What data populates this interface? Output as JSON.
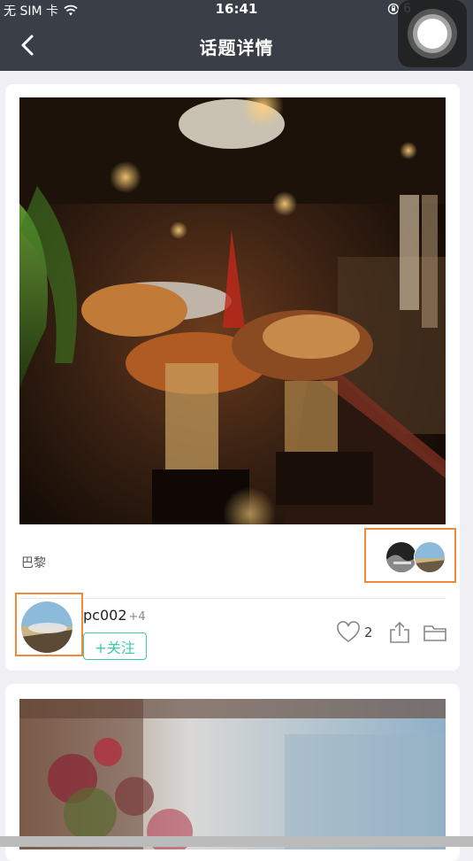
{
  "status_bar": {
    "carrier": "无 SIM 卡",
    "time": "16:41",
    "battery_partial": "6"
  },
  "nav": {
    "title": "话题详情",
    "back_icon": "chevron-left-icon"
  },
  "post": {
    "location": "巴黎",
    "author": {
      "username": "pc002",
      "extra": "+4"
    },
    "follow_label": "+关注",
    "likes": "2"
  },
  "colors": {
    "nav_bg": "#3a3e46",
    "accent": "#3cc9a8",
    "highlight_border": "#f08a3a",
    "page_bg": "#efeff4"
  }
}
